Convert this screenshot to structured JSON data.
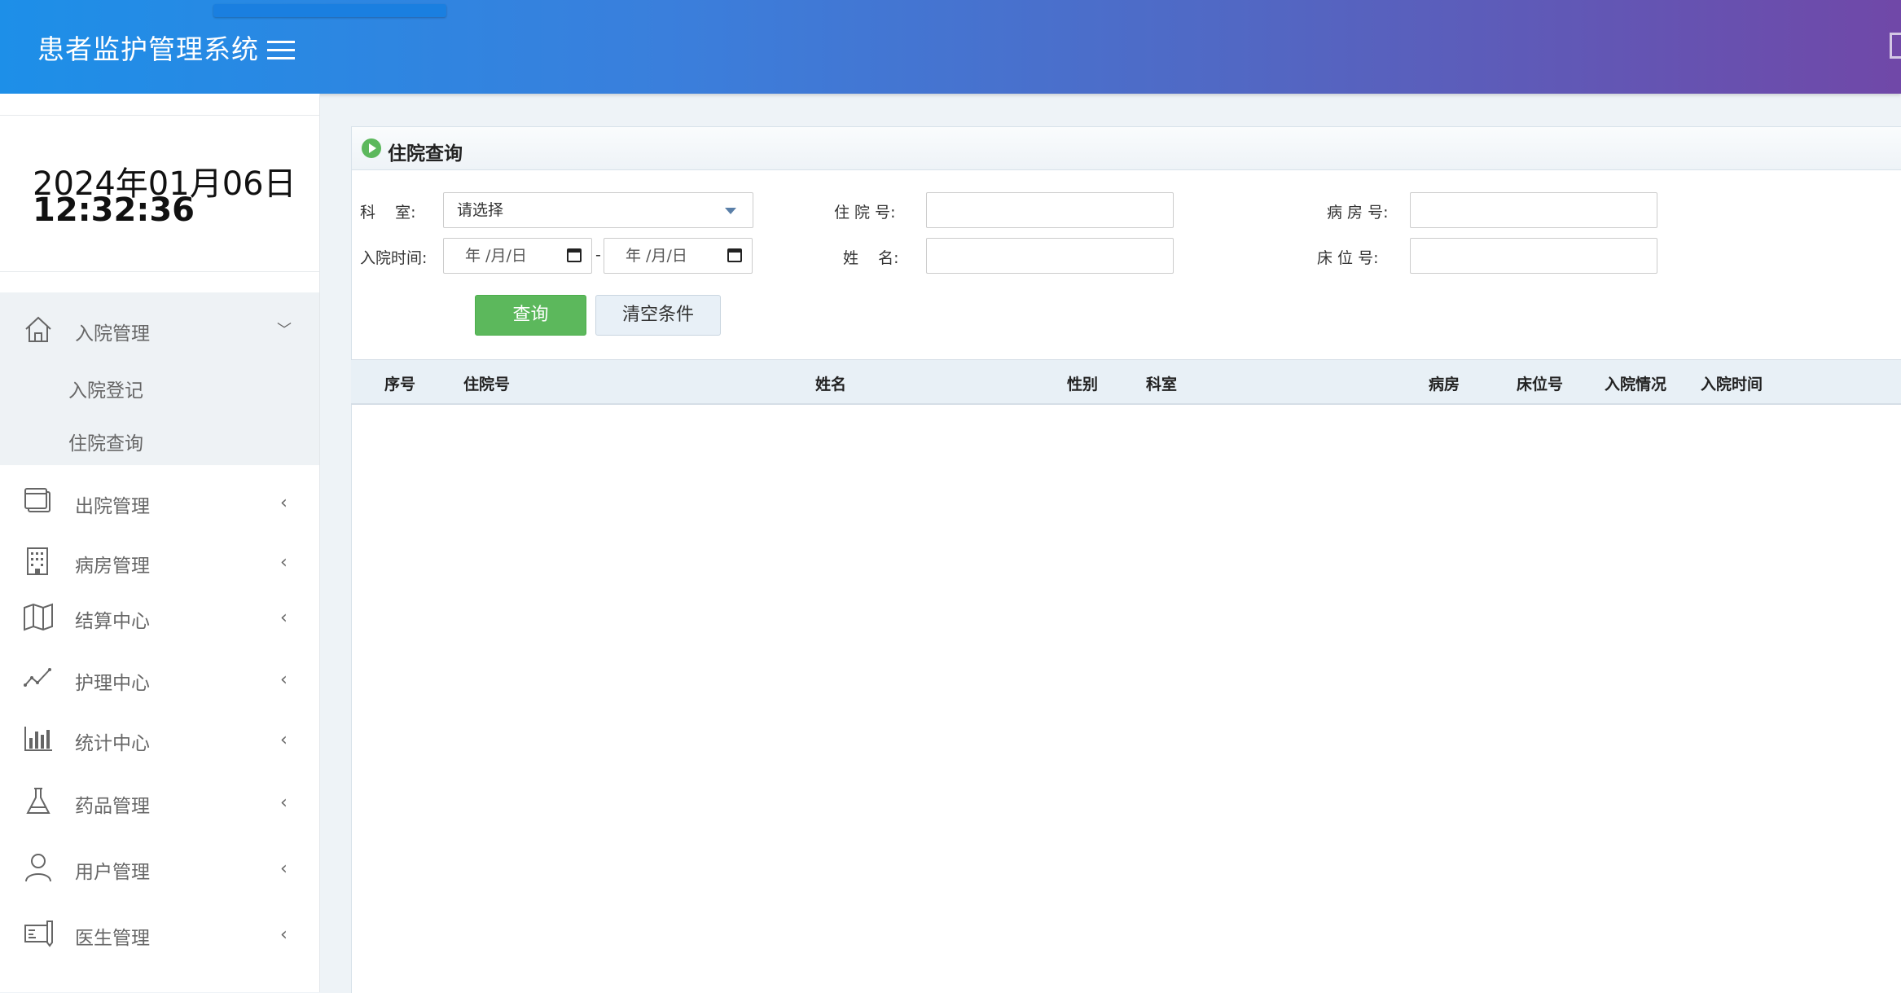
{
  "header": {
    "title": "患者监护管理系统"
  },
  "clock": {
    "date": "2024年01月06日",
    "time": "12:32:36"
  },
  "sidebar": {
    "items": [
      {
        "label": "入院管理",
        "icon": "home-icon",
        "arrow": "﹀",
        "children": [
          "入院登记",
          "住院查询"
        ]
      },
      {
        "label": "出院管理",
        "icon": "window-icon",
        "arrow": "‹"
      },
      {
        "label": "病房管理",
        "icon": "building-icon",
        "arrow": "‹"
      },
      {
        "label": "结算中心",
        "icon": "map-icon",
        "arrow": "‹"
      },
      {
        "label": "护理中心",
        "icon": "line-chart-icon",
        "arrow": "‹"
      },
      {
        "label": "统计中心",
        "icon": "bar-chart-icon",
        "arrow": "‹"
      },
      {
        "label": "药品管理",
        "icon": "flask-icon",
        "arrow": "‹"
      },
      {
        "label": "用户管理",
        "icon": "user-icon",
        "arrow": "‹"
      },
      {
        "label": "医生管理",
        "icon": "doctor-card-icon",
        "arrow": "‹"
      }
    ]
  },
  "panel": {
    "title": "住院查询",
    "form": {
      "department_label": "科    室:",
      "department_value": "请选择",
      "admission_no_label": "住 院 号:",
      "ward_no_label": "病 房 号:",
      "admit_time_label": "入院时间:",
      "date_placeholder": "年 /月/日",
      "date_separator": "-",
      "name_label": "姓    名:",
      "bed_no_label": "床 位 号:"
    },
    "buttons": {
      "query": "查询",
      "clear": "清空条件"
    },
    "table": {
      "columns": [
        "序号",
        "住院号",
        "姓名",
        "性别",
        "科室",
        "病房",
        "床位号",
        "入院情况",
        "入院时间"
      ],
      "rows": []
    }
  },
  "colors": {
    "header_start": "#1d8fe8",
    "header_end": "#7048a8",
    "query_button": "#5cb85c"
  }
}
